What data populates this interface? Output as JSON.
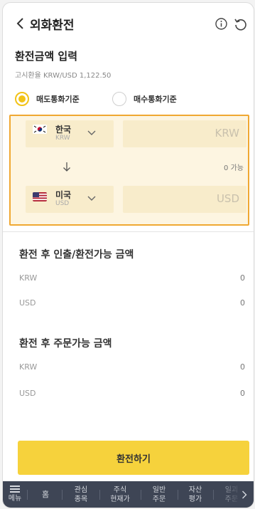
{
  "header": {
    "title": "외화환전",
    "back_icon": "chevron-left-icon",
    "info_icon": "info-icon",
    "refresh_icon": "refresh-icon"
  },
  "section": {
    "title": "환전금액 입력",
    "rate_label": "고시환율 KRW/USD 1,122.50",
    "radio": {
      "sell": "매도통화기준",
      "buy": "매수통화기준",
      "selected": "sell"
    }
  },
  "exchange": {
    "from": {
      "name": "한국",
      "code": "KRW",
      "amount_placeholder": "KRW"
    },
    "available": "0 가능",
    "to": {
      "name": "미국",
      "code": "USD",
      "amount_placeholder": "USD"
    }
  },
  "withdraw": {
    "title": "환전 후 인출/환전가능 금액",
    "rows": [
      {
        "k": "KRW",
        "v": "0"
      },
      {
        "k": "USD",
        "v": "0"
      }
    ]
  },
  "order": {
    "title": "환전 후 주문가능 금액",
    "rows": [
      {
        "k": "KRW",
        "v": "0"
      },
      {
        "k": "USD",
        "v": "0"
      }
    ]
  },
  "submit_label": "환전하기",
  "tabbar": {
    "menu": "메뉴",
    "home": "홈",
    "tabs": [
      [
        "관심",
        "종목"
      ],
      [
        "주식",
        "현재가"
      ],
      [
        "일반",
        "주문"
      ],
      [
        "자산",
        "평가"
      ],
      [
        "일괴",
        "주문"
      ]
    ]
  },
  "colors": {
    "accent": "#f6d23c",
    "highlight_border": "#f0a832",
    "tabbar": "#3e4555"
  }
}
